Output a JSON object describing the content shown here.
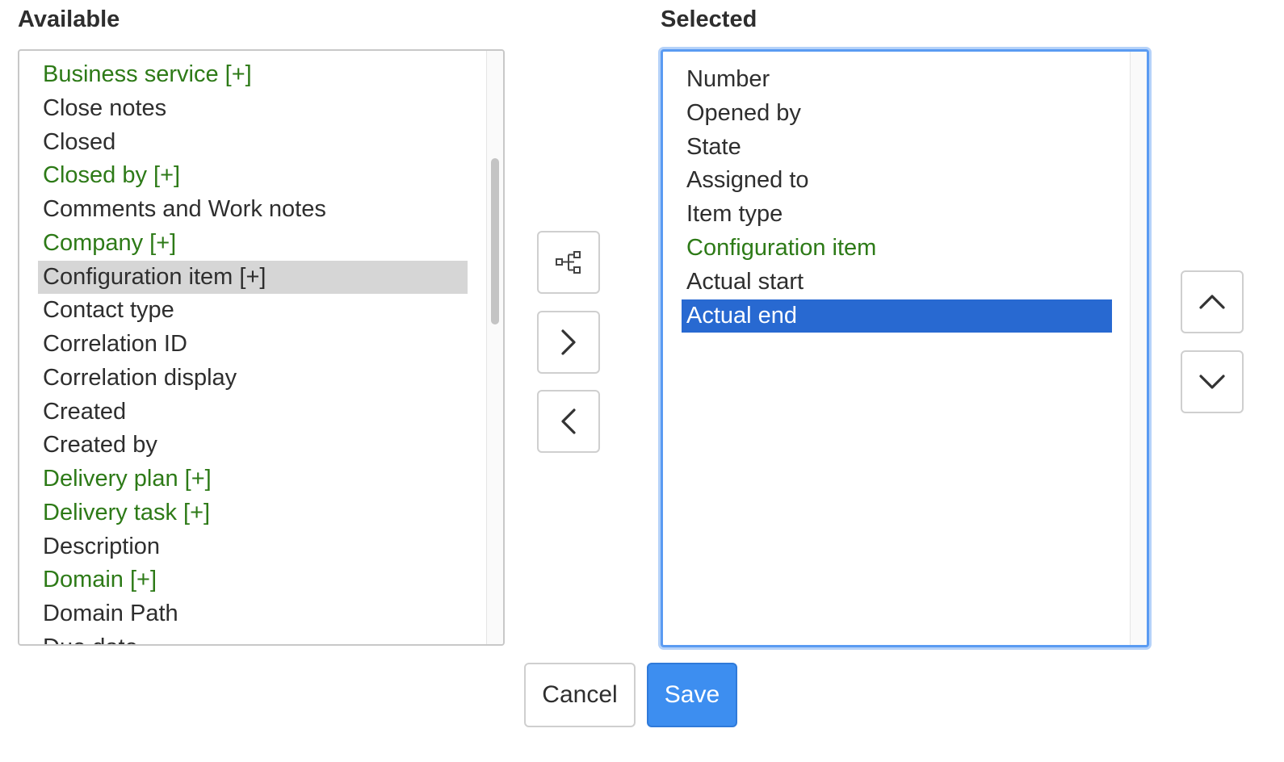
{
  "available": {
    "title": "Available",
    "items": [
      {
        "label": "Business service [+]",
        "color": "green"
      },
      {
        "label": "Close notes",
        "color": "dark"
      },
      {
        "label": "Closed",
        "color": "dark"
      },
      {
        "label": "Closed by [+]",
        "color": "green"
      },
      {
        "label": "Comments and Work notes",
        "color": "dark"
      },
      {
        "label": "Company [+]",
        "color": "green"
      },
      {
        "label": "Configuration item [+]",
        "color": "dark",
        "highlighted": true
      },
      {
        "label": "Contact type",
        "color": "dark"
      },
      {
        "label": "Correlation ID",
        "color": "dark"
      },
      {
        "label": "Correlation display",
        "color": "dark"
      },
      {
        "label": "Created",
        "color": "dark"
      },
      {
        "label": "Created by",
        "color": "dark"
      },
      {
        "label": "Delivery plan [+]",
        "color": "green"
      },
      {
        "label": "Delivery task [+]",
        "color": "green"
      },
      {
        "label": "Description",
        "color": "dark"
      },
      {
        "label": "Domain [+]",
        "color": "green"
      },
      {
        "label": "Domain Path",
        "color": "dark"
      },
      {
        "label": "Due date",
        "color": "dark"
      }
    ]
  },
  "selected": {
    "title": "Selected",
    "items": [
      {
        "label": "Number",
        "color": "dark"
      },
      {
        "label": "Opened by",
        "color": "dark"
      },
      {
        "label": "State",
        "color": "dark"
      },
      {
        "label": "Assigned to",
        "color": "dark"
      },
      {
        "label": "Item type",
        "color": "dark"
      },
      {
        "label": "Configuration item",
        "color": "green"
      },
      {
        "label": "Actual start",
        "color": "dark"
      },
      {
        "label": "Actual end",
        "color": "dark",
        "selected": true
      }
    ]
  },
  "icons": {
    "tree": "hierarchy-icon",
    "add": "chevron-right-icon",
    "remove": "chevron-left-icon",
    "up": "chevron-up-icon",
    "down": "chevron-down-icon"
  },
  "buttons": {
    "cancel": "Cancel",
    "save": "Save"
  },
  "colors": {
    "green_text": "#2d7a17",
    "selection_bg": "#2869d1",
    "highlight_bg": "#d6d6d6",
    "focus_border": "#5a9bf2",
    "save_bg": "#3d8ef0"
  }
}
